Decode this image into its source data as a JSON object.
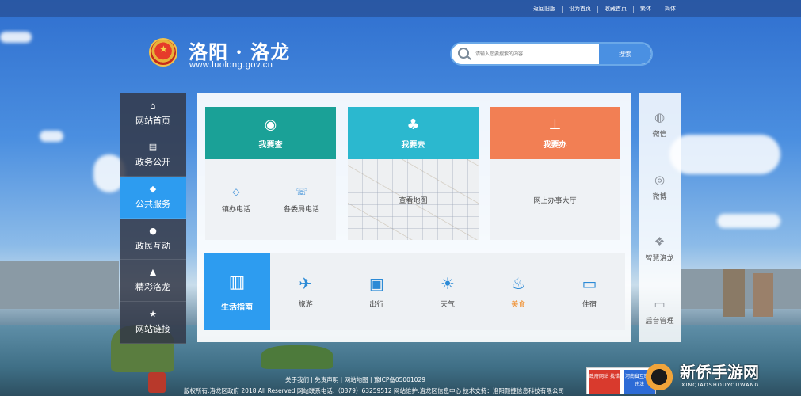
{
  "topbar": {
    "links": [
      "返回旧版",
      "设为首页",
      "收藏首页",
      "繁体",
      "简体"
    ]
  },
  "header": {
    "title": "洛阳 · 洛龙",
    "url": "www.luolong.gov.cn"
  },
  "search": {
    "placeholder": "请输入您要搜索的内容",
    "button_label": "搜索"
  },
  "sidebar": {
    "items": [
      {
        "label": "网站首页",
        "icon": "home-icon"
      },
      {
        "label": "政务公开",
        "icon": "document-icon"
      },
      {
        "label": "公共服务",
        "icon": "diamond-icon"
      },
      {
        "label": "政民互动",
        "icon": "chat-icon"
      },
      {
        "label": "精彩洛龙",
        "icon": "flame-icon"
      },
      {
        "label": "网站链接",
        "icon": "star-icon"
      }
    ],
    "active_index": 2
  },
  "cards": [
    {
      "title": "我要查",
      "color": "#1aa197",
      "subs": [
        "镇办电话",
        "各委局电话"
      ]
    },
    {
      "title": "我要去",
      "color": "#2bb8cf",
      "subs": [
        "查看地图"
      ]
    },
    {
      "title": "我要办",
      "color": "#f27f54",
      "subs": [
        "网上办事大厅"
      ]
    }
  ],
  "life": {
    "guide_label": "生活指南",
    "items": [
      "旅游",
      "出行",
      "天气",
      "美食",
      "住宿"
    ],
    "highlight_item": "美食",
    "highlight_color": "#f08a24"
  },
  "rightbar": {
    "items": [
      "微信",
      "微博",
      "智慧洛龙",
      "后台管理"
    ]
  },
  "footer": {
    "line1": "关于我们 | 免责声明 | 网站地图 | 豫ICP备05001029",
    "line2": "版权所有:洛龙区政府 2018 All Reserved 网站联系电话:（0379）63259512 网站维护:洛龙区信息中心 技术支持：洛阳颢捷信息科技有限公司",
    "badge1": "政府网站 找错",
    "badge2": "河南省互联网违法"
  },
  "watermark": {
    "title": "新侨手游网",
    "subtitle": "XINQIAOSHOUYOUWANG"
  }
}
